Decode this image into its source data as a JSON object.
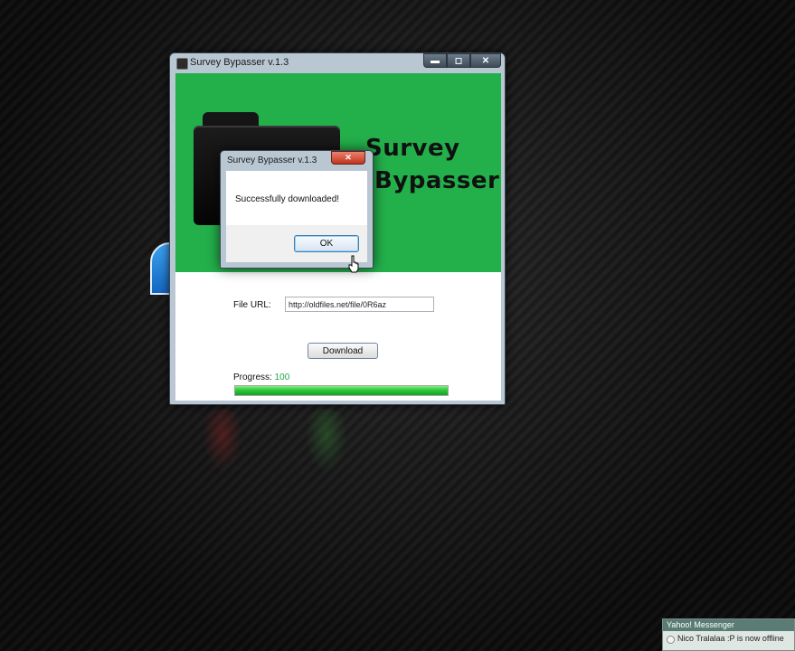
{
  "main_window": {
    "title": "Survey Bypasser v.1.3",
    "controls": {
      "minimize": "▬",
      "maximize": "◻",
      "close": "✕"
    },
    "banner": {
      "line1": "Survey",
      "line2": "Bypasser",
      "icon": "black-folder-icon"
    },
    "file_url": {
      "label": "File URL:",
      "value": "http://oldfiles.net/file/0R6az"
    },
    "download_button": "Download",
    "progress": {
      "label": "Progress:",
      "value": "100",
      "fraction": 1.0
    }
  },
  "dialog": {
    "title": "Survey Bypasser v.1.3",
    "close": "✕",
    "message": "Successfully downloaded!",
    "ok_button": "OK"
  },
  "notification": {
    "app": "Yahoo! Messenger",
    "message": "Nico Tralalaa :P is now offline"
  },
  "colors": {
    "banner_green": "#23b04b",
    "progress_green": "#2bc337",
    "close_red": "#c1351d"
  }
}
